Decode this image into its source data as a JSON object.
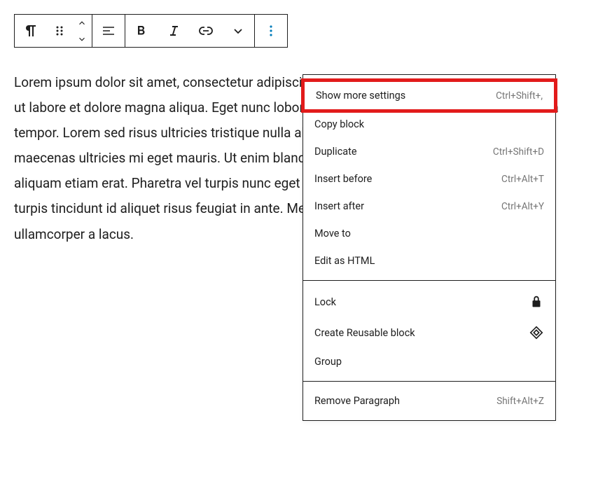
{
  "content": {
    "paragraph": "Lorem ipsum dolor sit amet, consectetur adipiscing elit, sed do eiusmod tempor incididunt ut labore et dolore magna aliqua. Eget nunc lobortis mattis aliquam faucibus purus in massa tempor. Lorem sed risus ultricies tristique nulla aliquet enim tortor at. Aliquam id diam maecenas ultricies mi eget mauris. Ut enim blandit volutpat maecenas volutpat blandit aliquam etiam erat. Pharetra vel turpis nunc eget lorem dolor sed viverra ipsum. Lacus sed turpis tincidunt id aliquet risus feugiat in ante. Metus dictum at tempor commodo ullamcorper a lacus."
  },
  "menu": {
    "section1": [
      {
        "label": "Show more settings",
        "shortcut": "Ctrl+Shift+,"
      },
      {
        "label": "Copy block",
        "shortcut": ""
      },
      {
        "label": "Duplicate",
        "shortcut": "Ctrl+Shift+D"
      },
      {
        "label": "Insert before",
        "shortcut": "Ctrl+Alt+T"
      },
      {
        "label": "Insert after",
        "shortcut": "Ctrl+Alt+Y"
      },
      {
        "label": "Move to",
        "shortcut": ""
      },
      {
        "label": "Edit as HTML",
        "shortcut": ""
      }
    ],
    "section2": [
      {
        "label": "Lock",
        "icon": "lock"
      },
      {
        "label": "Create Reusable block",
        "icon": "reusable"
      },
      {
        "label": "Group",
        "icon": ""
      }
    ],
    "section3": [
      {
        "label": "Remove Paragraph",
        "shortcut": "Shift+Alt+Z"
      }
    ]
  }
}
